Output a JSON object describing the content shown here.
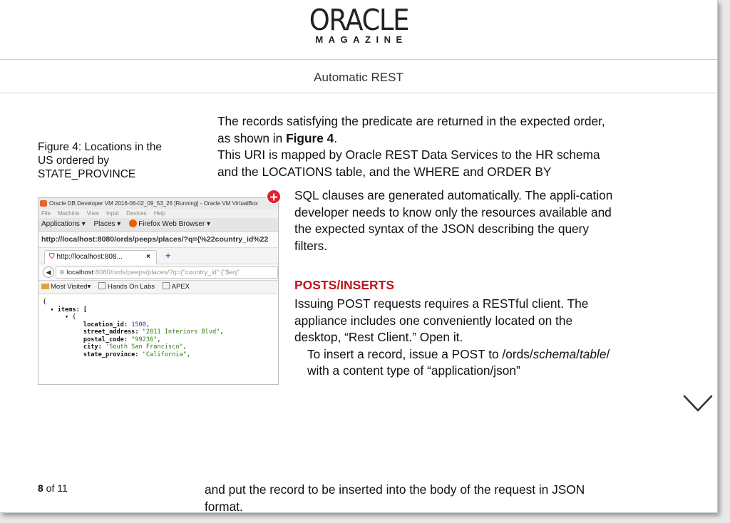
{
  "header": {
    "logo_main": "ORACLE",
    "logo_sub": "MAGAZINE",
    "section_title": "Automatic REST"
  },
  "figure": {
    "caption_label": "Figure 4:",
    "caption_text": " Locations in the US ordered by STATE_PROVINCE",
    "screenshot": {
      "vm_title": "Oracle DB Developer VM 2016-06-02_09_53_26 [Running] - Oracle VM VirtualBox",
      "vm_menu": [
        "File",
        "Machine",
        "View",
        "Input",
        "Devices",
        "Help"
      ],
      "gnome_applications": "Applications ▾",
      "gnome_places": "Places ▾",
      "gnome_firefox": "Firefox Web Browser ▾",
      "window_url": "http://localhost:8080/ords/peeps/places/?q={%22country_id%22",
      "tab_label": "http://localhost:808...",
      "tab_close": "×",
      "new_tab": "+",
      "back": "◀",
      "address_host": "localhost",
      "address_path": ":8080/ords/peeps/places/?q={\"country_id\":{\"$eq\"",
      "bookmarks": [
        "Most Visited▾",
        "Hands On Labs",
        "APEX"
      ],
      "json_lines": {
        "l1": "{",
        "l2_key": "  ▾ items: [",
        "l3": "      ▾ {",
        "l4_key": "           location_id: ",
        "l4_val": "1500",
        "l5_key": "           street_address: ",
        "l5_val": "\"2011 Interiors Blvd\"",
        "l6_key": "           postal_code: ",
        "l6_val": "\"99236\"",
        "l7_key": "           city: ",
        "l7_val": "'South San Francisco\"",
        "l8_key": "           state_province: ",
        "l8_val": "\"California\""
      }
    },
    "add_badge": "+"
  },
  "article": {
    "p1_a": "The records satisfying the predicate are returned in the expected order, as shown in ",
    "p1_fig": "Figure 4",
    "p1_b": ".",
    "p1_c": "This URI is mapped by Oracle REST Data Services to the HR schema and the LOCATIONS table, and the WHERE and ORDER BY",
    "p2": "SQL clauses are generated automatically. The appli-cation developer needs to know only the resources available and the expected syntax of the JSON describing the query filters.",
    "subhead": "POSTS/INSERTS",
    "p3_a": "Issuing POST requests requires a RESTful client. The appliance includes one conveniently located on the desktop, “Rest Client.” Open it.",
    "p3_b1": "To insert a record, issue a POST to /ords/",
    "p3_b_schema": "schema",
    "p3_b2": "/",
    "p3_b_table": "table",
    "p3_b3": "/ with a content type of “application/json”",
    "p4": "and put the record to be inserted into the body of the request in JSON format."
  },
  "pager": {
    "current": "8",
    "of_label": " of ",
    "total": "11"
  }
}
